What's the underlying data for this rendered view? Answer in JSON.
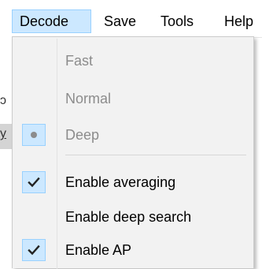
{
  "menubar": {
    "items": [
      {
        "label": "Decode",
        "active": true
      },
      {
        "label": "Save"
      },
      {
        "label": "Tools"
      },
      {
        "label": "Help"
      }
    ]
  },
  "background": {
    "glyph1": "ɔ",
    "glyph2": "y"
  },
  "decode_menu": {
    "items": [
      {
        "label": "Fast",
        "enabled": false,
        "checked": false
      },
      {
        "label": "Normal",
        "enabled": false,
        "checked": false
      },
      {
        "label": "Deep",
        "enabled": false,
        "selected_radio": true
      },
      {
        "label": "Enable averaging",
        "enabled": true,
        "checked": true
      },
      {
        "label": "Enable deep search",
        "enabled": true,
        "checked": false
      },
      {
        "label": "Enable AP",
        "enabled": true,
        "checked": true
      }
    ]
  },
  "colors": {
    "highlight_fill": "#cce8ff",
    "highlight_border": "#99d1ff",
    "menu_bg": "#f2f2f2",
    "disabled_text": "#8c8c8c"
  },
  "icons": {
    "check": "checkmark-icon",
    "radio": "radio-dot-icon"
  }
}
